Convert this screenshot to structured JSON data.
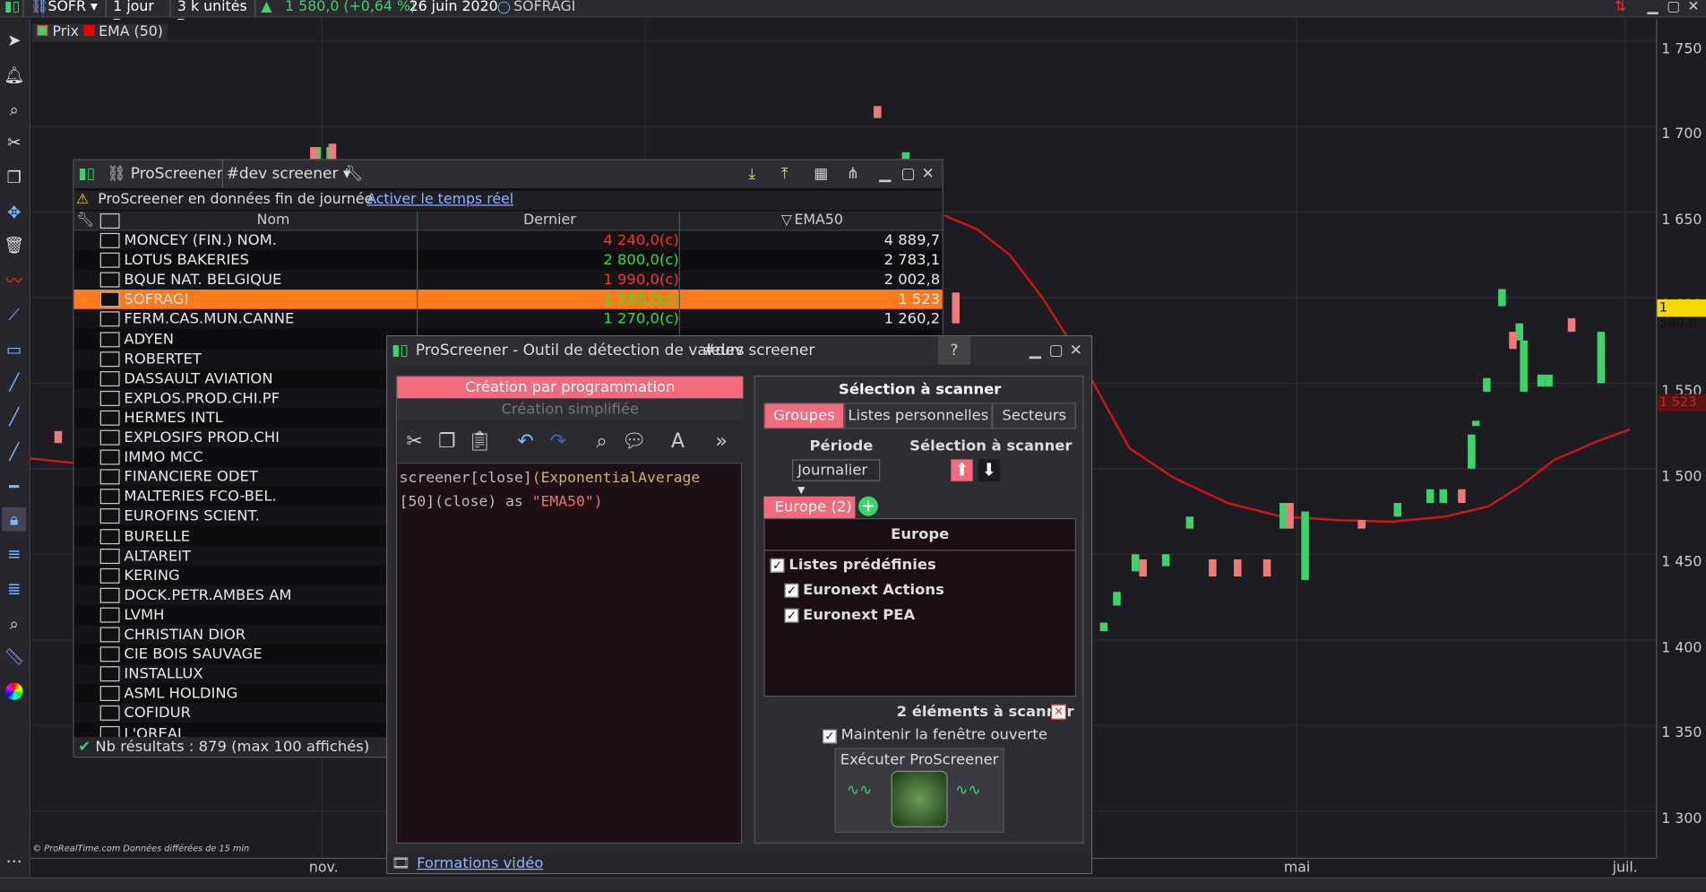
{
  "topbar": {
    "symbol": "SOFR",
    "period": "1 jour",
    "units": "3 k unités",
    "price_change": "1 580,0 (+0,64 %)",
    "date": "26 juin 2020",
    "name": "SOFRAGI"
  },
  "legend": {
    "prix": "Prix",
    "ema": "EMA (50)"
  },
  "yaxis": {
    "labels": [
      "1 750",
      "1 700",
      "1 650",
      "1 600",
      "1 550",
      "1 500",
      "1 450",
      "1 400",
      "1 350",
      "1 300"
    ],
    "current": "1 580,0",
    "ema_tag": "1 523"
  },
  "xaxis": {
    "labels": [
      "nov.",
      "mai",
      "juil."
    ]
  },
  "credit": "© ProRealTime.com  Données différées de 15 min",
  "proscreener": {
    "title": "ProScreener",
    "screener_name": "#dev screener",
    "warning": "ProScreener en données fin de journée.",
    "warning_link": "Activer le temps réel",
    "col_nom": "Nom",
    "col_dernier": "Dernier",
    "col_ema": "EMA50",
    "rows": [
      {
        "nom": "MONCEY (FIN.) NOM.",
        "dernier": "4 240,0(c)",
        "ema": "4 889,7",
        "color": "#ff3030"
      },
      {
        "nom": "LOTUS BAKERIES",
        "dernier": "2 800,0(c)",
        "ema": "2 783,1",
        "color": "#30e030"
      },
      {
        "nom": "BQUE NAT. BELGIQUE",
        "dernier": "1 990,0(c)",
        "ema": "2 002,8",
        "color": "#ff3030"
      },
      {
        "nom": "SOFRAGI",
        "dernier": "1 580,0(c)",
        "ema": "1 523",
        "color": "#30e030"
      },
      {
        "nom": "FERM.CAS.MUN.CANNE",
        "dernier": "1 270,0(c)",
        "ema": "1 260,2",
        "color": "#30e030"
      },
      {
        "nom": "ADYEN",
        "dernier": "",
        "ema": "",
        "color": ""
      },
      {
        "nom": "ROBERTET",
        "dernier": "",
        "ema": "",
        "color": ""
      },
      {
        "nom": "DASSAULT AVIATION",
        "dernier": "",
        "ema": "",
        "color": ""
      },
      {
        "nom": "EXPLOS.PROD.CHI.PF",
        "dernier": "",
        "ema": "",
        "color": ""
      },
      {
        "nom": "HERMES INTL",
        "dernier": "",
        "ema": "",
        "color": ""
      },
      {
        "nom": "EXPLOSIFS PROD.CHI",
        "dernier": "",
        "ema": "",
        "color": ""
      },
      {
        "nom": "IMMO MCC",
        "dernier": "",
        "ema": "",
        "color": ""
      },
      {
        "nom": "FINANCIERE ODET",
        "dernier": "",
        "ema": "",
        "color": ""
      },
      {
        "nom": "MALTERIES FCO-BEL.",
        "dernier": "",
        "ema": "",
        "color": ""
      },
      {
        "nom": "EUROFINS SCIENT.",
        "dernier": "",
        "ema": "",
        "color": ""
      },
      {
        "nom": "BURELLE",
        "dernier": "",
        "ema": "",
        "color": ""
      },
      {
        "nom": "ALTAREIT",
        "dernier": "",
        "ema": "",
        "color": ""
      },
      {
        "nom": "KERING",
        "dernier": "",
        "ema": "",
        "color": ""
      },
      {
        "nom": "DOCK.PETR.AMBES AM",
        "dernier": "",
        "ema": "",
        "color": ""
      },
      {
        "nom": "LVMH",
        "dernier": "",
        "ema": "",
        "color": ""
      },
      {
        "nom": "CHRISTIAN DIOR",
        "dernier": "",
        "ema": "",
        "color": ""
      },
      {
        "nom": "CIE BOIS SAUVAGE",
        "dernier": "",
        "ema": "",
        "color": ""
      },
      {
        "nom": "INSTALLUX",
        "dernier": "",
        "ema": "",
        "color": ""
      },
      {
        "nom": "ASML HOLDING",
        "dernier": "",
        "ema": "",
        "color": ""
      },
      {
        "nom": "COFIDUR",
        "dernier": "",
        "ema": "",
        "color": ""
      },
      {
        "nom": "L'OREAL",
        "dernier": "",
        "ema": "",
        "color": ""
      }
    ],
    "footer": "Nb résultats : 879 (max 100 affichés)"
  },
  "tool": {
    "title": "ProScreener - Outil de détection de valeurs",
    "screener_name": "#dev screener",
    "tab_prog": "Création par programmation",
    "tab_simple": "Création simplifiée",
    "code_line1a": "screener[close]",
    "code_line1b": "(ExponentialAverage",
    "code_line2a": "[50](close) as ",
    "code_line2b": "\"EMA50\")",
    "sel_title": "Sélection à scanner",
    "seg_groupes": "Groupes",
    "seg_listes": "Listes personnelles",
    "seg_secteurs": "Secteurs",
    "periode_label": "Période",
    "periode_value": "Journalier",
    "sel_label2": "Sélection à scanner",
    "group_tag": "Europe (2)",
    "europe_header": "Europe",
    "listes_predefinies": "Listes prédéfinies",
    "item1": "Euronext Actions",
    "item2": "Euronext PEA",
    "count": "2 éléments à scanner",
    "keep_open": "Maintenir la fenêtre ouverte",
    "execute": "Exécuter ProScreener",
    "footer_link": "Formations vidéo"
  },
  "chart_data": {
    "type": "candlestick",
    "ylim": [
      1270,
      1760
    ],
    "ema_series": [
      [
        0,
        1506
      ],
      [
        60,
        1502
      ],
      [
        150,
        1497
      ],
      [
        250,
        1492
      ],
      [
        350,
        1487
      ],
      [
        450,
        1483
      ],
      [
        840,
        1648
      ],
      [
        870,
        1640
      ],
      [
        900,
        1625
      ],
      [
        930,
        1600
      ],
      [
        960,
        1570
      ],
      [
        990,
        1535
      ],
      [
        1010,
        1512
      ],
      [
        1050,
        1495
      ],
      [
        1100,
        1480
      ],
      [
        1150,
        1472
      ],
      [
        1200,
        1470
      ],
      [
        1250,
        1469
      ],
      [
        1300,
        1472
      ],
      [
        1340,
        1478
      ],
      [
        1370,
        1490
      ],
      [
        1400,
        1505
      ],
      [
        1440,
        1516
      ],
      [
        1470,
        1523
      ]
    ],
    "candles_up": [
      [
        291,
        1672,
        1688
      ],
      [
        303,
        1660,
        1688
      ],
      [
        333,
        1672,
        1678
      ],
      [
        345,
        1672,
        1678
      ],
      [
        832,
        1668,
        1685
      ],
      [
        844,
        1670,
        1681
      ],
      [
        1014,
        1405,
        1410
      ],
      [
        1026,
        1420,
        1428
      ],
      [
        1043,
        1440,
        1450
      ],
      [
        1071,
        1443,
        1450
      ],
      [
        1093,
        1465,
        1472
      ],
      [
        1179,
        1465,
        1480
      ],
      [
        1199,
        1435,
        1475
      ],
      [
        1284,
        1472,
        1480
      ],
      [
        1314,
        1480,
        1488
      ],
      [
        1326,
        1480,
        1488
      ],
      [
        1352,
        1500,
        1520
      ],
      [
        1366,
        1545,
        1553
      ],
      [
        1380,
        1595,
        1605
      ],
      [
        1400,
        1545,
        1575
      ],
      [
        1416,
        1548,
        1555
      ],
      [
        1423,
        1548,
        1555
      ],
      [
        1471,
        1550,
        1580
      ],
      [
        1396,
        1575,
        1585
      ],
      [
        1356,
        1525,
        1528
      ]
    ],
    "candles_down": [
      [
        288,
        1672,
        1688
      ],
      [
        305,
        1672,
        1690
      ],
      [
        806,
        1705,
        1712
      ],
      [
        836,
        1673,
        1680
      ],
      [
        878,
        1585,
        1603
      ],
      [
        53,
        1515,
        1522
      ],
      [
        1050,
        1437,
        1447
      ],
      [
        1114,
        1437,
        1447
      ],
      [
        1137,
        1437,
        1447
      ],
      [
        1164,
        1437,
        1447
      ],
      [
        1185,
        1465,
        1480
      ],
      [
        1251,
        1465,
        1470
      ],
      [
        1343,
        1480,
        1488
      ],
      [
        1444,
        1580,
        1588
      ],
      [
        1390,
        1570,
        1580
      ]
    ]
  }
}
